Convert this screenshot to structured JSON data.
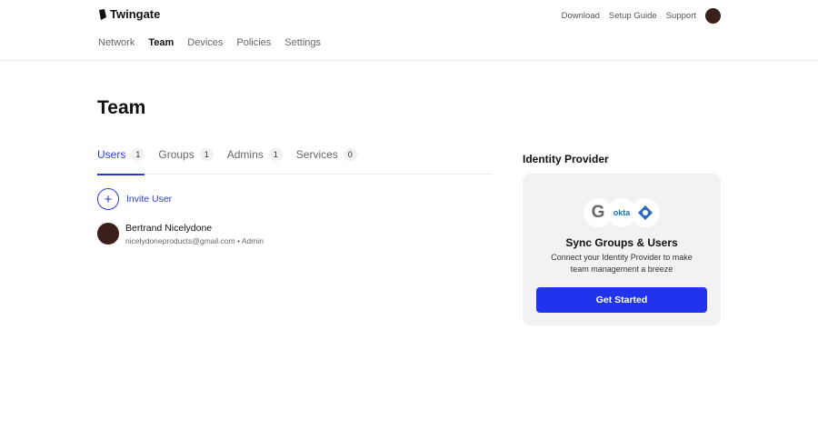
{
  "brand": "Twingate",
  "toplinks": [
    "Download",
    "Setup Guide",
    "Support"
  ],
  "nav": [
    "Network",
    "Team",
    "Devices",
    "Policies",
    "Settings"
  ],
  "title": "Team",
  "tabs": [
    {
      "label": "Users",
      "count": "1"
    },
    {
      "label": "Groups",
      "count": "1"
    },
    {
      "label": "Admins",
      "count": "1"
    },
    {
      "label": "Services",
      "count": "0"
    }
  ],
  "invite": "Invite User",
  "user": {
    "name": "Bertrand Nicelydone",
    "meta": "nicelydoneproducts@gmail.com • Admin"
  },
  "idp": {
    "title": "Identity Provider",
    "heading": "Sync Groups & Users",
    "text": "Connect your Identity Provider to make team management a breeze",
    "button": "Get Started",
    "okta": "okta",
    "google": "G"
  }
}
